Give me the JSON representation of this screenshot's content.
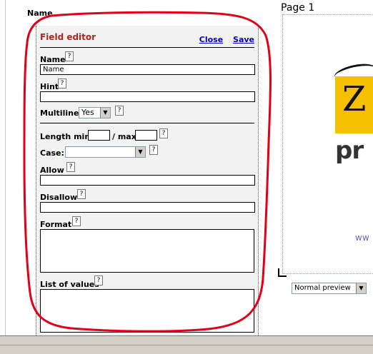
{
  "field_title": "Name",
  "editor": {
    "title": "Field editor",
    "close_label": "Close",
    "save_label": "Save",
    "help_glyph": "?",
    "name": {
      "label": "Name",
      "value": "Name"
    },
    "hint": {
      "label": "Hint",
      "value": ""
    },
    "multiline": {
      "label": "Multiline:",
      "value": "Yes"
    },
    "length": {
      "min_label": "Length min",
      "max_label": "/ max",
      "min_value": "",
      "max_value": ""
    },
    "case": {
      "label": "Case:",
      "value": ""
    },
    "allow": {
      "label": "Allow",
      "value": ""
    },
    "disallow": {
      "label": "Disallow",
      "value": ""
    },
    "format": {
      "label": "Format",
      "value": ""
    },
    "list_of_values": {
      "label": "List of values",
      "value": ""
    }
  },
  "preview_panel": {
    "page_label": "Page 1",
    "website_fragment": "ww",
    "mode_select": "Normal preview"
  },
  "colors": {
    "editor_title": "#b22222",
    "link": "#0000cc",
    "annotation": "#e0001a",
    "logo_yellow": "#f6c000"
  },
  "icons": {
    "help": "question-mark-icon",
    "dropdown": "chevron-down-icon"
  }
}
